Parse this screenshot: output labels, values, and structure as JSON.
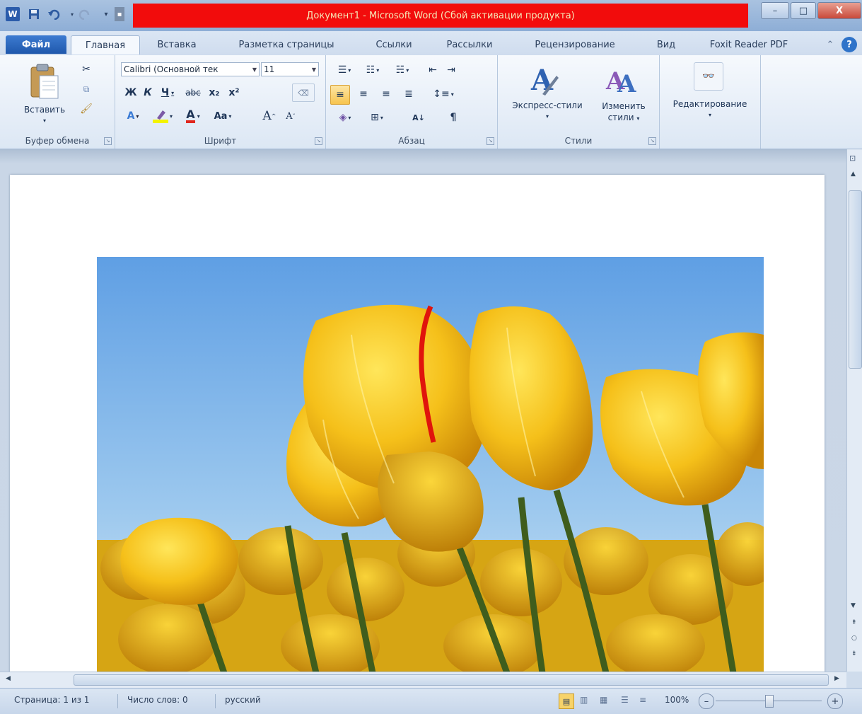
{
  "window": {
    "title": "Документ1 - Microsoft Word (Сбой активации продукта)",
    "controls": {
      "minimize": "–",
      "maximize": "□",
      "close": "X"
    }
  },
  "quick_access": {
    "icons": [
      "word-icon",
      "save-icon",
      "undo-icon",
      "redo-icon",
      "customize-icon"
    ]
  },
  "tabs": [
    "Файл",
    "Главная",
    "Вставка",
    "Разметка страницы",
    "Ссылки",
    "Рассылки",
    "Рецензирование",
    "Вид",
    "Foxit Reader PDF"
  ],
  "ribbon": {
    "clipboard": {
      "label": "Буфер обмена",
      "paste": "Вставить"
    },
    "font": {
      "label": "Шрифт",
      "font_name": "Calibri (Основной тек",
      "font_size": "11",
      "bold": "Ж",
      "italic": "К",
      "underline": "Ч",
      "strike": "abc",
      "subscript": "x₂",
      "superscript": "x²",
      "change_case": "Aa",
      "grow": "A",
      "shrink": "A",
      "text_effects": "A",
      "font_color": "A"
    },
    "paragraph": {
      "label": "Абзац",
      "pilcrow": "¶"
    },
    "styles": {
      "label": "Стили",
      "express": "Экспресс-стили",
      "change_1": "Изменить",
      "change_2": "стили"
    },
    "editing": {
      "label": "Редактирование"
    }
  },
  "statusbar": {
    "page": "Страница: 1 из 1",
    "words": "Число слов: 0",
    "language": "русский",
    "zoom": "100%",
    "zoom_out": "–",
    "zoom_in": "+"
  },
  "colors": {
    "title_highlight": "#f20c0c",
    "file_tab": "#2a67bd",
    "ribbon_bg": "#e9f0f8"
  }
}
